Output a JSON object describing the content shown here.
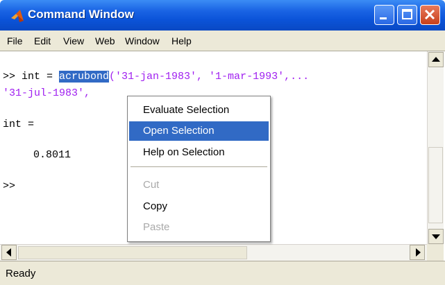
{
  "window": {
    "title": "Command Window",
    "icon": "matlab-logo-icon"
  },
  "menu": [
    "File",
    "Edit",
    "View",
    "Web",
    "Window",
    "Help"
  ],
  "console": {
    "line1_prompt": ">> int = ",
    "line1_selected": "acrubond",
    "line1_rest": "('31-jan-1983', '1-mar-1993',...",
    "line2": "'31-jul-1983',",
    "line3": "int =",
    "line4": "0.8011",
    "line5": ">>"
  },
  "context_menu": {
    "items": [
      {
        "label": "Evaluate Selection",
        "state": "normal"
      },
      {
        "label": "Open Selection",
        "state": "highlighted"
      },
      {
        "label": "Help on Selection",
        "state": "normal"
      },
      {
        "label": "Cut",
        "state": "disabled"
      },
      {
        "label": "Copy",
        "state": "normal"
      },
      {
        "label": "Paste",
        "state": "disabled"
      }
    ]
  },
  "status": "Ready",
  "colors": {
    "titlebar": "#0b53d8",
    "selection": "#316ac5",
    "string": "#a020f0"
  }
}
